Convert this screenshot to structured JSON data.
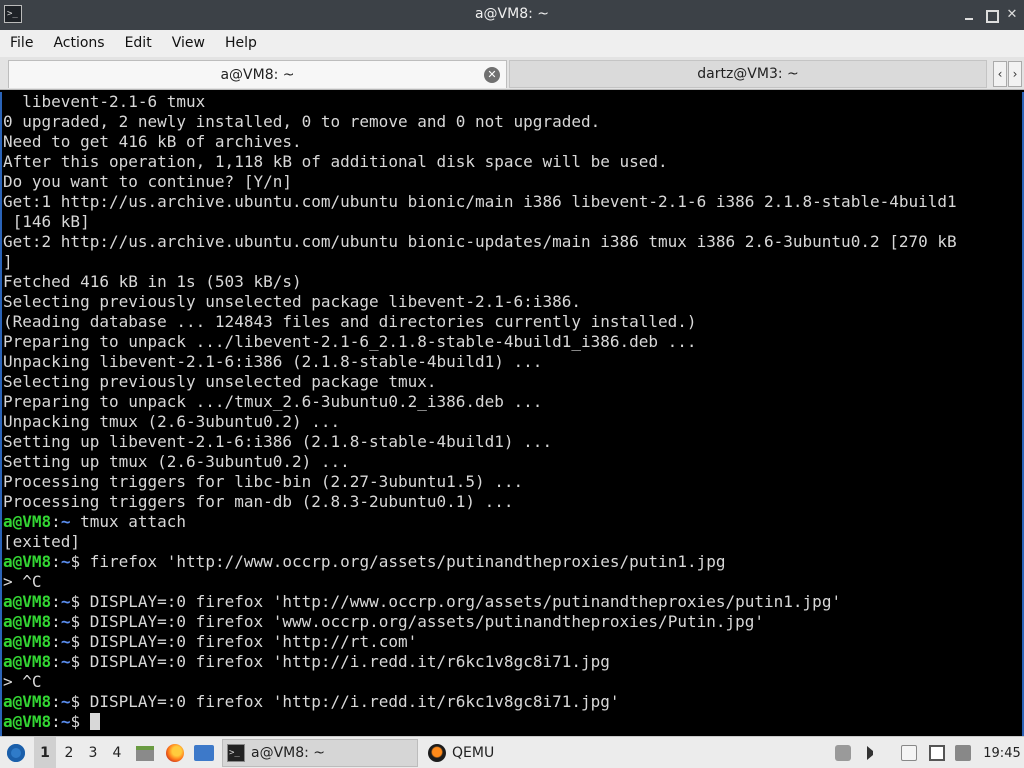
{
  "window": {
    "title": "a@VM8: ~",
    "app_icon": "terminal-icon",
    "controls": [
      "minimize-icon",
      "maximize-icon",
      "close-icon"
    ]
  },
  "menubar": {
    "items": [
      "File",
      "Actions",
      "Edit",
      "View",
      "Help"
    ]
  },
  "tabs": [
    {
      "label": "a@VM8: ~",
      "active": true
    },
    {
      "label": "dartz@VM3: ~",
      "active": false
    }
  ],
  "tab_scroll": {
    "left": "‹",
    "right": "›"
  },
  "terminal": {
    "colors": {
      "prompt": "#33d633",
      "path": "#5b8ef0",
      "text": "#d8d8d8",
      "background": "#000000"
    },
    "lines": [
      {
        "text": "  libevent-2.1-6 tmux"
      },
      {
        "text": "0 upgraded, 2 newly installed, 0 to remove and 0 not upgraded."
      },
      {
        "text": "Need to get 416 kB of archives."
      },
      {
        "text": "After this operation, 1,118 kB of additional disk space will be used."
      },
      {
        "text": "Do you want to continue? [Y/n]"
      },
      {
        "text": "Get:1 http://us.archive.ubuntu.com/ubuntu bionic/main i386 libevent-2.1-6 i386 2.1.8-stable-4build1"
      },
      {
        "text": " [146 kB]"
      },
      {
        "text": "Get:2 http://us.archive.ubuntu.com/ubuntu bionic-updates/main i386 tmux i386 2.6-3ubuntu0.2 [270 kB"
      },
      {
        "text": "]"
      },
      {
        "text": "Fetched 416 kB in 1s (503 kB/s)"
      },
      {
        "text": "Selecting previously unselected package libevent-2.1-6:i386."
      },
      {
        "text": "(Reading database ... 124843 files and directories currently installed.)"
      },
      {
        "text": "Preparing to unpack .../libevent-2.1-6_2.1.8-stable-4build1_i386.deb ..."
      },
      {
        "text": "Unpacking libevent-2.1-6:i386 (2.1.8-stable-4build1) ..."
      },
      {
        "text": "Selecting previously unselected package tmux."
      },
      {
        "text": "Preparing to unpack .../tmux_2.6-3ubuntu0.2_i386.deb ..."
      },
      {
        "text": "Unpacking tmux (2.6-3ubuntu0.2) ..."
      },
      {
        "text": "Setting up libevent-2.1-6:i386 (2.1.8-stable-4build1) ..."
      },
      {
        "text": "Setting up tmux (2.6-3ubuntu0.2) ..."
      },
      {
        "text": "Processing triggers for libc-bin (2.27-3ubuntu1.5) ..."
      },
      {
        "text": "Processing triggers for man-db (2.8.3-2ubuntu0.1) ..."
      },
      {
        "prompt": "a@VM8",
        "sep": ":",
        "path": "~",
        "text": " tmux attach"
      },
      {
        "text": "[exited]"
      },
      {
        "prompt": "a@VM8",
        "sep": ":",
        "path": "~",
        "text": "$ firefox 'http://www.occrp.org/assets/putinandtheproxies/putin1.jpg"
      },
      {
        "text": "> ^C"
      },
      {
        "prompt": "a@VM8",
        "sep": ":",
        "path": "~",
        "text": "$ DISPLAY=:0 firefox 'http://www.occrp.org/assets/putinandtheproxies/putin1.jpg'"
      },
      {
        "prompt": "a@VM8",
        "sep": ":",
        "path": "~",
        "text": "$ DISPLAY=:0 firefox 'www.occrp.org/assets/putinandtheproxies/Putin.jpg'"
      },
      {
        "prompt": "a@VM8",
        "sep": ":",
        "path": "~",
        "text": "$ DISPLAY=:0 firefox 'http://rt.com'"
      },
      {
        "prompt": "a@VM8",
        "sep": ":",
        "path": "~",
        "text": "$ DISPLAY=:0 firefox 'http://i.redd.it/r6kc1v8gc8i71.jpg"
      },
      {
        "text": "> ^C"
      },
      {
        "prompt": "a@VM8",
        "sep": ":",
        "path": "~",
        "text": "$ DISPLAY=:0 firefox 'http://i.redd.it/r6kc1v8gc8i71.jpg'"
      },
      {
        "prompt": "a@VM8",
        "sep": ":",
        "path": "~",
        "text": "$ ",
        "cursor": true
      }
    ]
  },
  "taskbar": {
    "start_icon": "start-menu-icon",
    "workspaces": [
      "1",
      "2",
      "3",
      "4"
    ],
    "active_workspace": "1",
    "quicklaunch": [
      "files-icon",
      "firefox-icon",
      "show-desktop-icon"
    ],
    "tasks": [
      {
        "label": "a@VM8: ~",
        "icon": "terminal-icon",
        "active": true
      },
      {
        "label": "QEMU",
        "icon": "qemu-icon",
        "active": false
      }
    ],
    "tray": [
      "screenshot-icon",
      "volume-icon",
      "clipboard-icon",
      "network-icon",
      "update-icon"
    ],
    "clock": "19:45"
  }
}
